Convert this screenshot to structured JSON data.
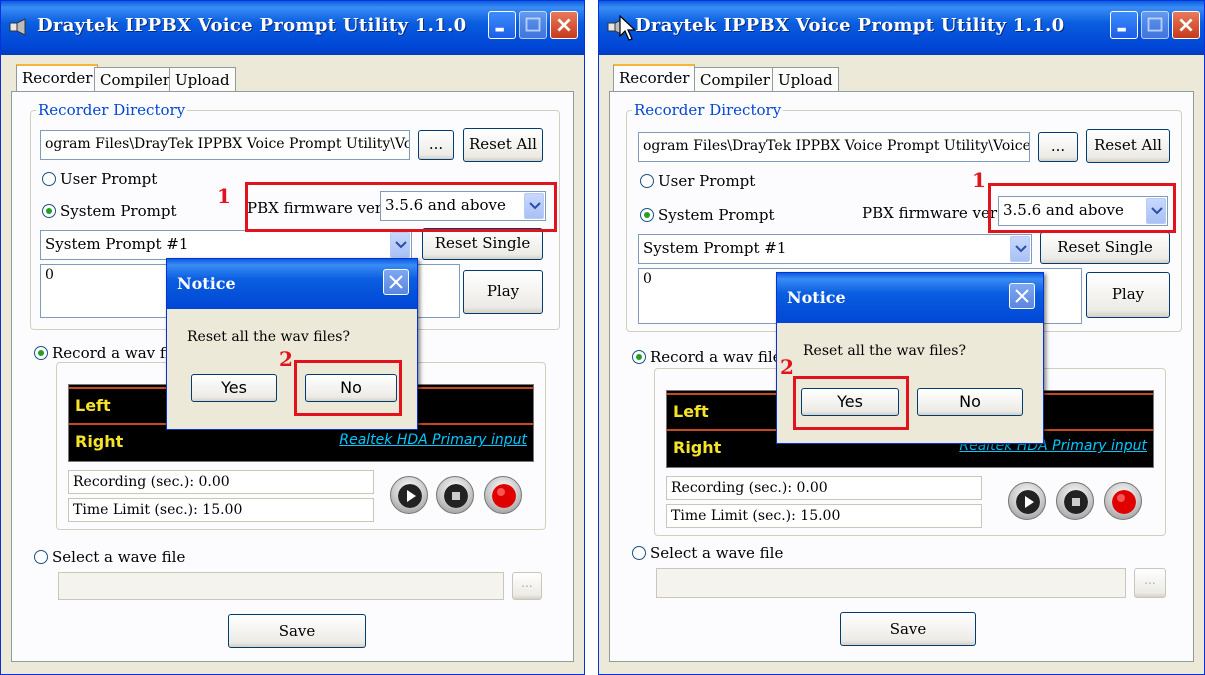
{
  "app": {
    "title": "Draytek IPPBX Voice Prompt Utility 1.1.0",
    "tabs": [
      "Recorder",
      "Compiler",
      "Upload"
    ]
  },
  "recorder": {
    "directory_label": "Recorder Directory",
    "directory_value": "ogram Files\\DrayTek IPPBX Voice Prompt Utility\\Voice",
    "browse_label": "...",
    "reset_all_label": "Reset All",
    "user_prompt_label": "User Prompt",
    "system_prompt_label": "System Prompt",
    "pbx_firmware_label": "PBX firmware ver.",
    "pbx_firmware_label_right": "PBX firmware ver",
    "pbx_firmware_value": "3.5.6 and above",
    "prompt_select_value": "System Prompt #1",
    "reset_single_label": "Reset Single",
    "prompt_text_value": "0",
    "play_label": "Play"
  },
  "record": {
    "record_option_label": "Record a wav file",
    "meter_left_label": "Left",
    "meter_right_label": "Right",
    "input_source": "Realtek HDA Primary input",
    "recording_label": "Recording (sec.): 0.00",
    "time_limit_label": "Time Limit (sec.): 15.00",
    "select_wave_label": "Select a wave file",
    "browse_label": "...",
    "save_label": "Save"
  },
  "dialog": {
    "title": "Notice",
    "message": "Reset all the wav files?",
    "yes_label": "Yes",
    "no_label": "No"
  },
  "annotations": {
    "step1": "1",
    "step2": "2"
  },
  "colors": {
    "title_blue": "#0a5ee0",
    "highlight_red": "#e1141d",
    "meter_yellow": "#f5e22a",
    "meter_link": "#00c8ff",
    "record_red": "#e00000"
  }
}
